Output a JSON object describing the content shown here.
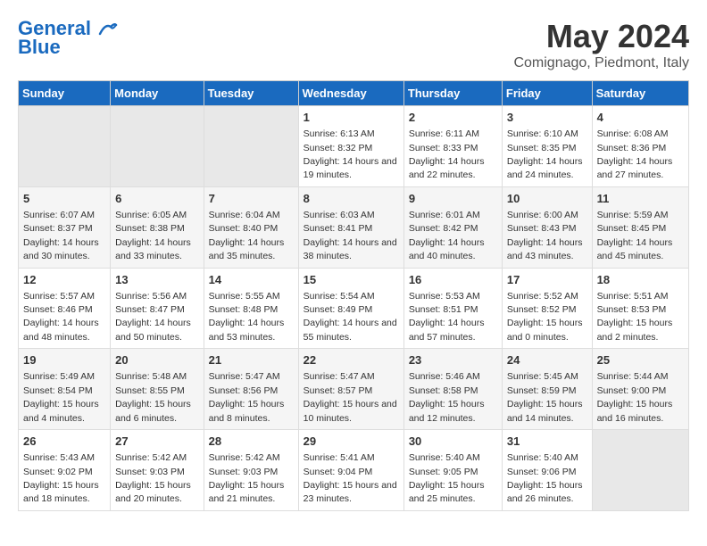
{
  "app": {
    "logo_line1": "General",
    "logo_line2": "Blue"
  },
  "header": {
    "month_year": "May 2024",
    "location": "Comignago, Piedmont, Italy"
  },
  "weekdays": [
    "Sunday",
    "Monday",
    "Tuesday",
    "Wednesday",
    "Thursday",
    "Friday",
    "Saturday"
  ],
  "weeks": [
    [
      {
        "day": "",
        "empty": true
      },
      {
        "day": "",
        "empty": true
      },
      {
        "day": "",
        "empty": true
      },
      {
        "day": "1",
        "sunrise": "Sunrise: 6:13 AM",
        "sunset": "Sunset: 8:32 PM",
        "daylight": "Daylight: 14 hours and 19 minutes."
      },
      {
        "day": "2",
        "sunrise": "Sunrise: 6:11 AM",
        "sunset": "Sunset: 8:33 PM",
        "daylight": "Daylight: 14 hours and 22 minutes."
      },
      {
        "day": "3",
        "sunrise": "Sunrise: 6:10 AM",
        "sunset": "Sunset: 8:35 PM",
        "daylight": "Daylight: 14 hours and 24 minutes."
      },
      {
        "day": "4",
        "sunrise": "Sunrise: 6:08 AM",
        "sunset": "Sunset: 8:36 PM",
        "daylight": "Daylight: 14 hours and 27 minutes."
      }
    ],
    [
      {
        "day": "5",
        "sunrise": "Sunrise: 6:07 AM",
        "sunset": "Sunset: 8:37 PM",
        "daylight": "Daylight: 14 hours and 30 minutes."
      },
      {
        "day": "6",
        "sunrise": "Sunrise: 6:05 AM",
        "sunset": "Sunset: 8:38 PM",
        "daylight": "Daylight: 14 hours and 33 minutes."
      },
      {
        "day": "7",
        "sunrise": "Sunrise: 6:04 AM",
        "sunset": "Sunset: 8:40 PM",
        "daylight": "Daylight: 14 hours and 35 minutes."
      },
      {
        "day": "8",
        "sunrise": "Sunrise: 6:03 AM",
        "sunset": "Sunset: 8:41 PM",
        "daylight": "Daylight: 14 hours and 38 minutes."
      },
      {
        "day": "9",
        "sunrise": "Sunrise: 6:01 AM",
        "sunset": "Sunset: 8:42 PM",
        "daylight": "Daylight: 14 hours and 40 minutes."
      },
      {
        "day": "10",
        "sunrise": "Sunrise: 6:00 AM",
        "sunset": "Sunset: 8:43 PM",
        "daylight": "Daylight: 14 hours and 43 minutes."
      },
      {
        "day": "11",
        "sunrise": "Sunrise: 5:59 AM",
        "sunset": "Sunset: 8:45 PM",
        "daylight": "Daylight: 14 hours and 45 minutes."
      }
    ],
    [
      {
        "day": "12",
        "sunrise": "Sunrise: 5:57 AM",
        "sunset": "Sunset: 8:46 PM",
        "daylight": "Daylight: 14 hours and 48 minutes."
      },
      {
        "day": "13",
        "sunrise": "Sunrise: 5:56 AM",
        "sunset": "Sunset: 8:47 PM",
        "daylight": "Daylight: 14 hours and 50 minutes."
      },
      {
        "day": "14",
        "sunrise": "Sunrise: 5:55 AM",
        "sunset": "Sunset: 8:48 PM",
        "daylight": "Daylight: 14 hours and 53 minutes."
      },
      {
        "day": "15",
        "sunrise": "Sunrise: 5:54 AM",
        "sunset": "Sunset: 8:49 PM",
        "daylight": "Daylight: 14 hours and 55 minutes."
      },
      {
        "day": "16",
        "sunrise": "Sunrise: 5:53 AM",
        "sunset": "Sunset: 8:51 PM",
        "daylight": "Daylight: 14 hours and 57 minutes."
      },
      {
        "day": "17",
        "sunrise": "Sunrise: 5:52 AM",
        "sunset": "Sunset: 8:52 PM",
        "daylight": "Daylight: 15 hours and 0 minutes."
      },
      {
        "day": "18",
        "sunrise": "Sunrise: 5:51 AM",
        "sunset": "Sunset: 8:53 PM",
        "daylight": "Daylight: 15 hours and 2 minutes."
      }
    ],
    [
      {
        "day": "19",
        "sunrise": "Sunrise: 5:49 AM",
        "sunset": "Sunset: 8:54 PM",
        "daylight": "Daylight: 15 hours and 4 minutes."
      },
      {
        "day": "20",
        "sunrise": "Sunrise: 5:48 AM",
        "sunset": "Sunset: 8:55 PM",
        "daylight": "Daylight: 15 hours and 6 minutes."
      },
      {
        "day": "21",
        "sunrise": "Sunrise: 5:47 AM",
        "sunset": "Sunset: 8:56 PM",
        "daylight": "Daylight: 15 hours and 8 minutes."
      },
      {
        "day": "22",
        "sunrise": "Sunrise: 5:47 AM",
        "sunset": "Sunset: 8:57 PM",
        "daylight": "Daylight: 15 hours and 10 minutes."
      },
      {
        "day": "23",
        "sunrise": "Sunrise: 5:46 AM",
        "sunset": "Sunset: 8:58 PM",
        "daylight": "Daylight: 15 hours and 12 minutes."
      },
      {
        "day": "24",
        "sunrise": "Sunrise: 5:45 AM",
        "sunset": "Sunset: 8:59 PM",
        "daylight": "Daylight: 15 hours and 14 minutes."
      },
      {
        "day": "25",
        "sunrise": "Sunrise: 5:44 AM",
        "sunset": "Sunset: 9:00 PM",
        "daylight": "Daylight: 15 hours and 16 minutes."
      }
    ],
    [
      {
        "day": "26",
        "sunrise": "Sunrise: 5:43 AM",
        "sunset": "Sunset: 9:02 PM",
        "daylight": "Daylight: 15 hours and 18 minutes."
      },
      {
        "day": "27",
        "sunrise": "Sunrise: 5:42 AM",
        "sunset": "Sunset: 9:03 PM",
        "daylight": "Daylight: 15 hours and 20 minutes."
      },
      {
        "day": "28",
        "sunrise": "Sunrise: 5:42 AM",
        "sunset": "Sunset: 9:03 PM",
        "daylight": "Daylight: 15 hours and 21 minutes."
      },
      {
        "day": "29",
        "sunrise": "Sunrise: 5:41 AM",
        "sunset": "Sunset: 9:04 PM",
        "daylight": "Daylight: 15 hours and 23 minutes."
      },
      {
        "day": "30",
        "sunrise": "Sunrise: 5:40 AM",
        "sunset": "Sunset: 9:05 PM",
        "daylight": "Daylight: 15 hours and 25 minutes."
      },
      {
        "day": "31",
        "sunrise": "Sunrise: 5:40 AM",
        "sunset": "Sunset: 9:06 PM",
        "daylight": "Daylight: 15 hours and 26 minutes."
      },
      {
        "day": "",
        "empty": true
      }
    ]
  ]
}
